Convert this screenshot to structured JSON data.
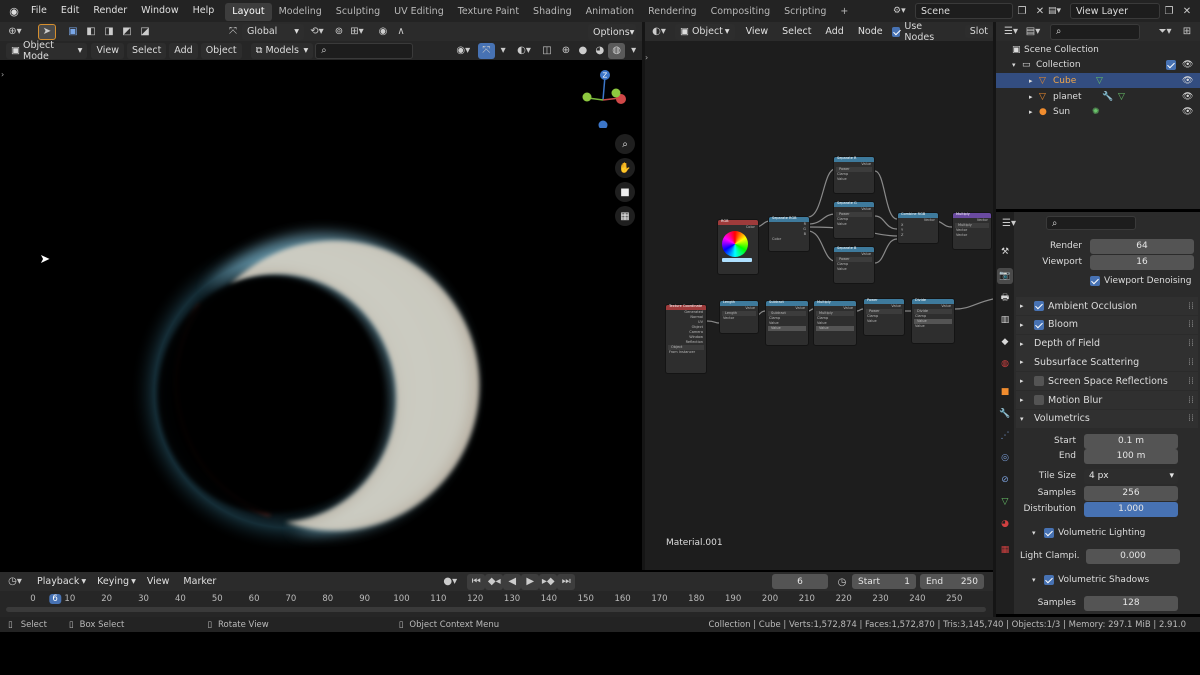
{
  "topbar": {
    "menus": [
      "File",
      "Edit",
      "Render",
      "Window",
      "Help"
    ],
    "workspaces": [
      "Layout",
      "Modeling",
      "Sculpting",
      "UV Editing",
      "Texture Paint",
      "Shading",
      "Animation",
      "Rendering",
      "Compositing",
      "Scripting"
    ],
    "add_tab": "+",
    "scene": "Scene",
    "view_layer": "View Layer"
  },
  "viewport": {
    "orientation": "Global",
    "mode": "Object Mode",
    "menus": [
      "View",
      "Select",
      "Add",
      "Object"
    ],
    "collection_filter": "Models",
    "options": "Options",
    "gizmo_axes": [
      "X",
      "Y",
      "Z"
    ]
  },
  "node_editor": {
    "header": {
      "type": "Object",
      "menus": [
        "View",
        "Select",
        "Add",
        "Node"
      ],
      "use_nodes": "Use Nodes",
      "slot": "Slot"
    },
    "material_name": "Material.001",
    "nodes": [
      {
        "title": "RGB",
        "color": "#9e3b3b",
        "rows": [
          "Color"
        ]
      },
      {
        "title": "Separate RGB",
        "color": "#3e7a9c",
        "rows": [
          "R",
          "G",
          "B",
          "Color"
        ]
      },
      {
        "title": "Separate R",
        "color": "#3e7a9c",
        "rows": [
          "Value",
          "Power",
          "Clamp",
          "Value"
        ]
      },
      {
        "title": "Separate G",
        "color": "#3e7a9c",
        "rows": [
          "Value",
          "Power",
          "Clamp",
          "Value"
        ]
      },
      {
        "title": "Separate B",
        "color": "#3e7a9c",
        "rows": [
          "Value",
          "Power",
          "Clamp",
          "Value"
        ]
      },
      {
        "title": "Combine RGB",
        "color": "#3e7a9c",
        "rows": [
          "Vector",
          "X",
          "Y",
          "Z"
        ]
      },
      {
        "title": "Multiply",
        "color": "#6a4aa0",
        "rows": [
          "Vector",
          "Multiply",
          "Vector",
          "Vector"
        ]
      },
      {
        "title": "Texture Coordinate",
        "color": "#9e3b3b",
        "rows": [
          "Generated",
          "Normal",
          "UV",
          "Object",
          "Camera",
          "Window",
          "Reflection",
          "Object",
          "From Instancer"
        ]
      },
      {
        "title": "Length",
        "color": "#3e7a9c",
        "rows": [
          "Value",
          "Length",
          "Vector"
        ]
      },
      {
        "title": "Subtract",
        "color": "#3e7a9c",
        "rows": [
          "Value",
          "Subtract",
          "Clamp",
          "Value",
          "Value"
        ]
      },
      {
        "title": "Multiply",
        "color": "#3e7a9c",
        "rows": [
          "Value",
          "Multiply",
          "Clamp",
          "Value",
          "Value"
        ]
      },
      {
        "title": "Power",
        "color": "#3e7a9c",
        "rows": [
          "Value",
          "Power",
          "Clamp",
          "Value"
        ]
      },
      {
        "title": "Divide",
        "color": "#3e7a9c",
        "rows": [
          "Value",
          "Divide",
          "Clamp",
          "Value",
          "Value"
        ]
      }
    ]
  },
  "outliner": {
    "root": "Scene Collection",
    "collection": "Collection",
    "items": [
      {
        "name": "Cube",
        "selected": true
      },
      {
        "name": "planet",
        "selected": false
      },
      {
        "name": "Sun",
        "selected": false
      }
    ]
  },
  "properties": {
    "render_label": "Render",
    "render_value": "64",
    "viewport_label": "Viewport",
    "viewport_value": "16",
    "viewport_denoising": "Viewport Denoising",
    "panels": [
      {
        "name": "Ambient Occlusion",
        "checkbox": true,
        "checked": true
      },
      {
        "name": "Bloom",
        "checkbox": true,
        "checked": true
      },
      {
        "name": "Depth of Field",
        "checkbox": false,
        "checked": false
      },
      {
        "name": "Subsurface Scattering",
        "checkbox": false,
        "checked": false
      },
      {
        "name": "Screen Space Reflections",
        "checkbox": true,
        "checked": false
      },
      {
        "name": "Motion Blur",
        "checkbox": true,
        "checked": false
      },
      {
        "name": "Volumetrics",
        "checkbox": false,
        "checked": false
      }
    ],
    "vol": {
      "start_label": "Start",
      "start": "0.1 m",
      "end_label": "End",
      "end": "100 m",
      "tile_label": "Tile Size",
      "tile": "4 px",
      "samples_label": "Samples",
      "samples": "256",
      "dist_label": "Distribution",
      "dist": "1.000"
    },
    "vol_lighting": "Volumetric Lighting",
    "light_clamp_label": "Light Clampi...",
    "light_clamp": "0.000",
    "vol_shadows": "Volumetric Shadows",
    "shadow_samples_label": "Samples",
    "shadow_samples": "128"
  },
  "timeline": {
    "menus": [
      "Playback",
      "Keying",
      "View",
      "Marker"
    ],
    "current_frame": "6",
    "start_label": "Start",
    "start": "1",
    "end_label": "End",
    "end": "250",
    "ticks": [
      "0",
      "6",
      "10",
      "20",
      "30",
      "40",
      "50",
      "60",
      "70",
      "80",
      "90",
      "100",
      "110",
      "120",
      "130",
      "140",
      "150",
      "160",
      "170",
      "180",
      "190",
      "200",
      "210",
      "220",
      "230",
      "240",
      "250"
    ]
  },
  "status": {
    "select": "Select",
    "box_select": "Box Select",
    "rotate": "Rotate View",
    "context": "Object Context Menu",
    "info": "Collection | Cube | Verts:1,572,874 | Faces:1,572,870 | Tris:3,145,740 | Objects:1/3 | Memory: 297.1 MiB | 2.91.0"
  },
  "colors": {
    "accent": "#4772b3",
    "selected_row": "#334d80",
    "active_tab": "#3d3d3d"
  }
}
